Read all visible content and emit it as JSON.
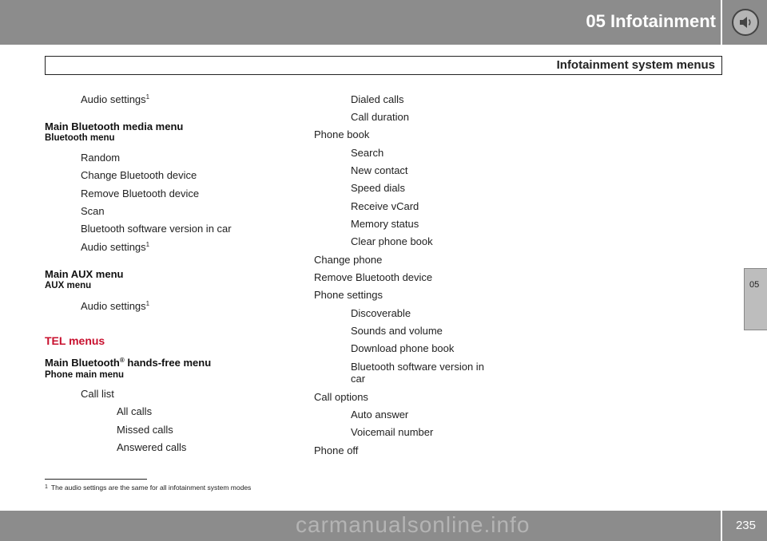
{
  "header": {
    "title": "05  Infotainment",
    "speaker_icon": "speaker-icon"
  },
  "subheader": {
    "title": "Infotainment system menus"
  },
  "side_tab": {
    "label": "05"
  },
  "left_column": {
    "audio_settings_top": "Audio settings",
    "bt_media_heading": "Main Bluetooth media menu",
    "bt_menu_subheading": "Bluetooth menu",
    "bt_items": [
      "Random",
      "Change Bluetooth device",
      "Remove Bluetooth device",
      "Scan",
      "Bluetooth software version in car"
    ],
    "bt_audio_settings": "Audio settings",
    "aux_heading": "Main AUX menu",
    "aux_subheading": "AUX menu",
    "aux_audio_settings": "Audio settings",
    "tel_heading": "TEL menus",
    "handsfree_heading_pre": "Main Bluetooth",
    "handsfree_reg": "®",
    "handsfree_heading_post": " hands-free menu",
    "phone_main_subheading": "Phone main menu",
    "call_list": "Call list",
    "call_list_items": [
      "All calls",
      "Missed calls",
      "Answered calls"
    ],
    "footnote_mark": "1"
  },
  "right_column": {
    "call_list_cont": [
      "Dialed calls",
      "Call duration"
    ],
    "phone_book": "Phone book",
    "phone_book_items": [
      "Search",
      "New contact",
      "Speed dials",
      "Receive vCard",
      "Memory status",
      "Clear phone book"
    ],
    "change_phone": "Change phone",
    "remove_bt_device": "Remove Bluetooth device",
    "phone_settings": "Phone settings",
    "phone_settings_items": [
      "Discoverable",
      "Sounds and volume",
      "Download phone book"
    ],
    "bt_sw_version_line1": "Bluetooth software version in",
    "bt_sw_version_line2": "car",
    "call_options": "Call options",
    "call_options_items": [
      "Auto answer",
      "Voicemail number"
    ],
    "phone_off": "Phone off"
  },
  "footnote": {
    "mark": "1",
    "text": "The audio settings are the same for all infotainment system modes"
  },
  "footer": {
    "page_number": "235",
    "watermark": "carmanualsonline.info"
  }
}
